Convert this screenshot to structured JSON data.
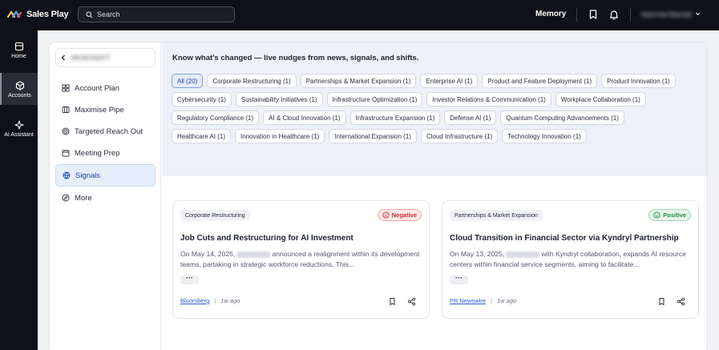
{
  "app": {
    "brand": "Sales Play"
  },
  "search": {
    "placeholder": "Search"
  },
  "topbar": {
    "memory_label": "Memory",
    "user_name": "Aanchal Bansal"
  },
  "rail": [
    {
      "label": "Home",
      "icon": "home-icon"
    },
    {
      "label": "Accounts",
      "icon": "cube-icon",
      "active": true
    },
    {
      "label": "AI Assistant",
      "icon": "sparkle-icon"
    }
  ],
  "subnav": {
    "account_name": "MICROSOFT",
    "items": [
      {
        "label": "Account Plan",
        "icon": "grid-icon"
      },
      {
        "label": "Maximise Pipe",
        "icon": "columns-icon"
      },
      {
        "label": "Targeted Reach Out",
        "icon": "target-icon"
      },
      {
        "label": "Meeting Prep",
        "icon": "calendar-icon"
      },
      {
        "label": "Signals",
        "icon": "globe-icon",
        "active": true
      },
      {
        "label": "More",
        "icon": "compass-icon"
      }
    ]
  },
  "signals": {
    "headline": "Know what’s changed — live nudges from news, signals, and shifts.",
    "filters": [
      "All (20)",
      "Corporate Restructuring (1)",
      "Partnerships & Market Expansion (1)",
      "Enterprise AI (1)",
      "Product and Feature Deployment (1)",
      "Product Innovation (1)",
      "Cybersecurity (1)",
      "Sustainability Initiatives (1)",
      "Infrastructure Optimization (1)",
      "Investor Relations & Communication (1)",
      "Workplace Collaboration (1)",
      "Regulatory Compliance (1)",
      "AI & Cloud Innovation (1)",
      "Infrastructure Expansion (1)",
      "Defense AI (1)",
      "Quantum Computing Advancements (1)",
      "Healthcare AI (1)",
      "Innovation in Healthcare (1)",
      "International Expansion (1)",
      "Cloud Infrastructure (1)",
      "Technology Innovation (1)"
    ],
    "active_filter": "All (20)",
    "cards": [
      {
        "tag": "Corporate Restructuring",
        "sentiment": "Negative",
        "title": "Job Cuts and Restructuring for AI Investment",
        "body_prefix": "On May 14, 2025,",
        "body_rest": "announced a realignment within its development teams, partaking in strategic workforce reductions. This...",
        "source": "Bloomberg",
        "time": "1w ago"
      },
      {
        "tag": "Partnerships & Market Expansion",
        "sentiment": "Positive",
        "title": "Cloud Transition in Financial Sector via Kyndryl Partnership",
        "body_prefix": "On May 13, 2025,",
        "body_rest": "with Kyndryl collaboration, expands AI resource centers within financial service segments, aiming to facilitate...",
        "source": "PR Newswire",
        "time": "1w ago"
      }
    ]
  },
  "colors": {
    "accent": "#1e47a8",
    "negative": "#c53030",
    "positive": "#23863f",
    "topbar": "#0f1019"
  }
}
